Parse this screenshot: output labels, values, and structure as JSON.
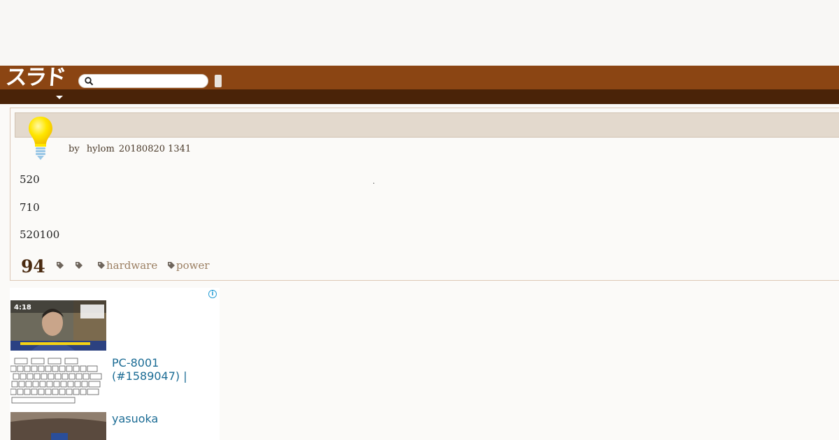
{
  "header": {
    "logo_text": "スラド",
    "search": {
      "placeholder": "",
      "value": ""
    },
    "colors": {
      "header_bg": "#8b4513",
      "subnav_bg": "#4a2308"
    }
  },
  "article": {
    "byline": {
      "by": "by",
      "author": "hylom",
      "date": "20180820 1341"
    },
    "paragraphs": [
      "520",
      "710",
      "520100"
    ],
    "dot": ".",
    "comment_count": "94",
    "tags": [
      "",
      "",
      "hardware",
      "power"
    ]
  },
  "ad": {
    "items": [
      {
        "thumb": "news-video",
        "duration": "4:18",
        "title": ""
      },
      {
        "thumb": "keyboard",
        "title": "PC-8001 (#1589047) |"
      },
      {
        "thumb": "stage-photo",
        "title": "yasuoka"
      }
    ]
  }
}
